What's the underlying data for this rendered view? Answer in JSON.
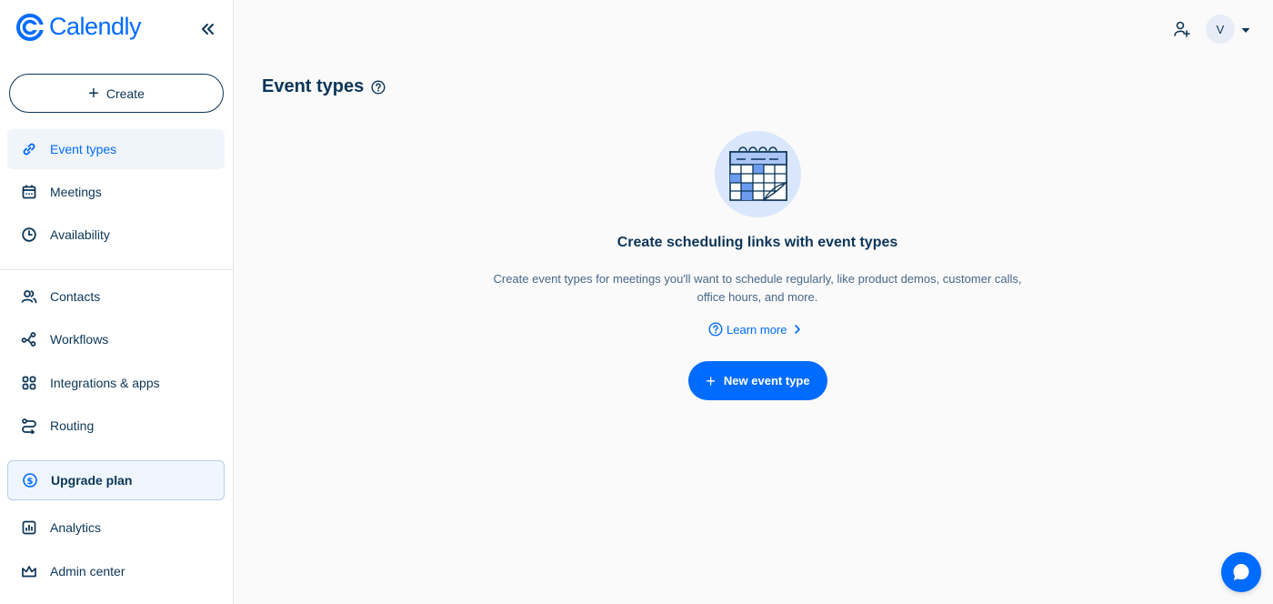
{
  "brand": {
    "name": "Calendly",
    "accent": "#006bff",
    "text_dark": "#0b3558"
  },
  "sidebar": {
    "create_label": "Create",
    "items": [
      {
        "label": "Event types",
        "icon": "link-icon",
        "active": true
      },
      {
        "label": "Meetings",
        "icon": "calendar-icon"
      },
      {
        "label": "Availability",
        "icon": "clock-icon"
      },
      {
        "label": "Contacts",
        "icon": "contacts-icon"
      },
      {
        "label": "Workflows",
        "icon": "workflows-icon"
      },
      {
        "label": "Integrations & apps",
        "icon": "apps-grid-icon"
      },
      {
        "label": "Routing",
        "icon": "routing-icon"
      },
      {
        "label": "Upgrade plan",
        "icon": "dollar-icon"
      },
      {
        "label": "Analytics",
        "icon": "analytics-icon"
      },
      {
        "label": "Admin center",
        "icon": "crown-icon"
      }
    ]
  },
  "header": {
    "avatar_initial": "V"
  },
  "main": {
    "title": "Event types",
    "empty_state": {
      "title": "Create scheduling links with event types",
      "description_line1": "Create event types for meetings you'll want to schedule regularly, like product demos, customer calls,",
      "description_line2": "office hours, and more.",
      "learn_more": "Learn more",
      "cta": "New event type"
    }
  }
}
